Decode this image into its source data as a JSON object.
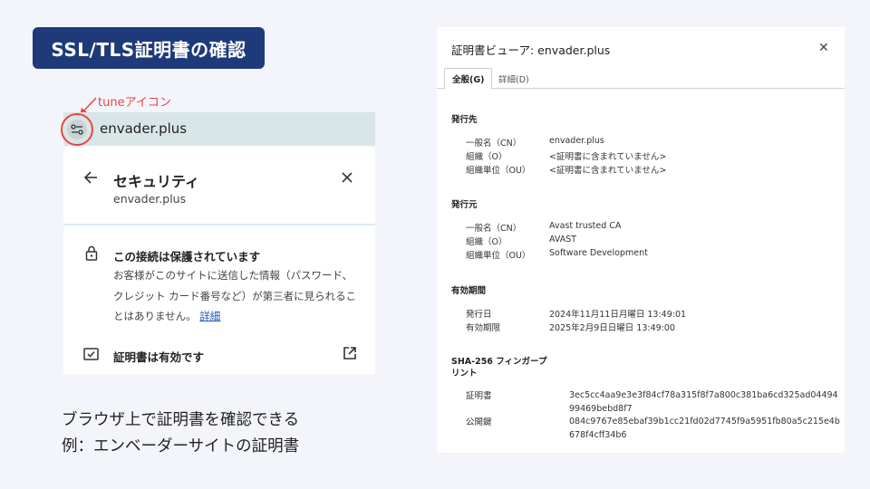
{
  "slide": {
    "title": "SSL/TLS証明書の確認",
    "annotation": "tuneアイコン",
    "caption_line1": "ブラウザ上で証明書を確認できる",
    "caption_line2": "例：エンベーダーサイトの証明書"
  },
  "browser": {
    "domain": "envader.plus",
    "security_panel": {
      "title": "セキュリティ",
      "domain": "envader.plus",
      "connection_title": "この接続は保護されています",
      "connection_desc": "お客様がこのサイトに送信した情報（パスワード、クレジット カード番号など）が第三者に見られることはありません。",
      "details_link": "詳細",
      "cert_status": "証明書は有効です"
    }
  },
  "viewer": {
    "title": "証明書ビューア: envader.plus",
    "tabs": [
      "全般(G)",
      "詳細(D)"
    ],
    "issued_to": {
      "heading": "発行先",
      "rows": [
        {
          "label": "一般名（CN）",
          "value": "envader.plus"
        },
        {
          "label": "組織（O）",
          "value": "<証明書に含まれていません>"
        },
        {
          "label": "組織単位（OU）",
          "value": "<証明書に含まれていません>"
        }
      ]
    },
    "issued_by": {
      "heading": "発行元",
      "rows": [
        {
          "label": "一般名（CN）",
          "value": "Avast trusted CA"
        },
        {
          "label": "組織（O）",
          "value": "AVAST"
        },
        {
          "label": "組織単位（OU）",
          "value": "Software Development"
        }
      ]
    },
    "validity": {
      "heading": "有効期間",
      "rows": [
        {
          "label": "発行日",
          "value": "2024年11月11日月曜日 13:49:01"
        },
        {
          "label": "有効期限",
          "value": "2025年2月9日日曜日 13:49:00"
        }
      ]
    },
    "fingerprints": {
      "heading_line1": "SHA-256 フィンガープ",
      "heading_line2": "リント",
      "rows": [
        {
          "label": "証明書",
          "value": "3ec5cc4aa9e3e3f84cf78a315f8f7a800c381ba6cd325ad0449499469bebd8f7"
        },
        {
          "label": "公開鍵",
          "value": "084c9767e85ebaf39b1cc21fd02d7745f9a5951fb80a5c215e4b678f4cff34b6"
        }
      ]
    }
  },
  "colors": {
    "title_bg": "#1f3a7a",
    "annotation": "#e8463d",
    "link": "#1a56b8"
  }
}
